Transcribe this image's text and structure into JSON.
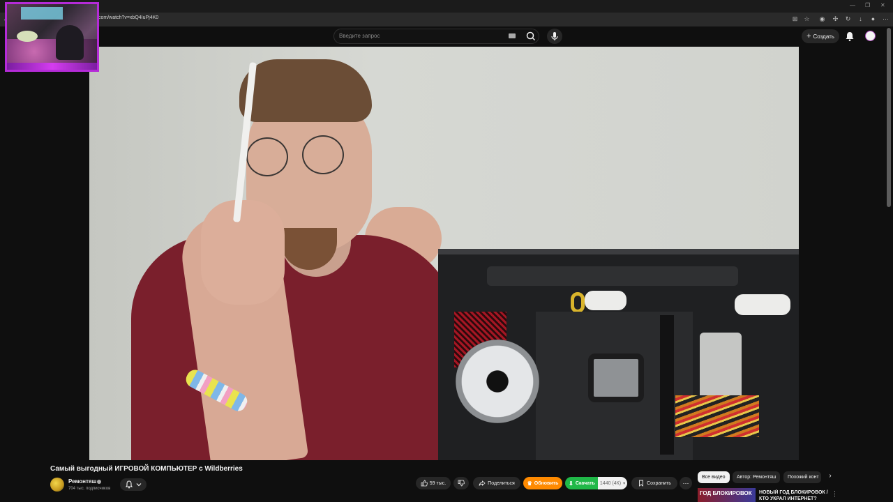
{
  "browser": {
    "url": "com/watch?v=xbQ4IuPj4K0"
  },
  "header": {
    "search_placeholder": "Введите запрос",
    "create_label": "Создать"
  },
  "video": {
    "title": "Самый выгодный ИГРОВОЙ КОМПЬЮТЕР с Wildberries"
  },
  "channel": {
    "name": "Ремонтяш",
    "subscribers": "704 тыс. подписчиков"
  },
  "actions": {
    "likes": "59 тыс.",
    "share_label": "Поделиться",
    "upgrade_label": "Обновить",
    "download_label": "Скачать",
    "download_quality": "1440 (4К)",
    "save_label": "Сохранить"
  },
  "chips": {
    "all": "Все видео",
    "author": "Автор: Ремонтяш",
    "similar": "Похожий конт"
  },
  "recommendation": {
    "thumb_text": "ГОД БЛОКИРОВОК",
    "title": "НОВЫЙ ГОД БЛОКИРОВОК / КТО УКРАЛ ИНТЕРНЕТ?"
  },
  "colors": {
    "background": "#0f0f0f",
    "upgrade": "#ff8a00",
    "download": "#20b848",
    "overlay_border": "#b52bd8"
  }
}
